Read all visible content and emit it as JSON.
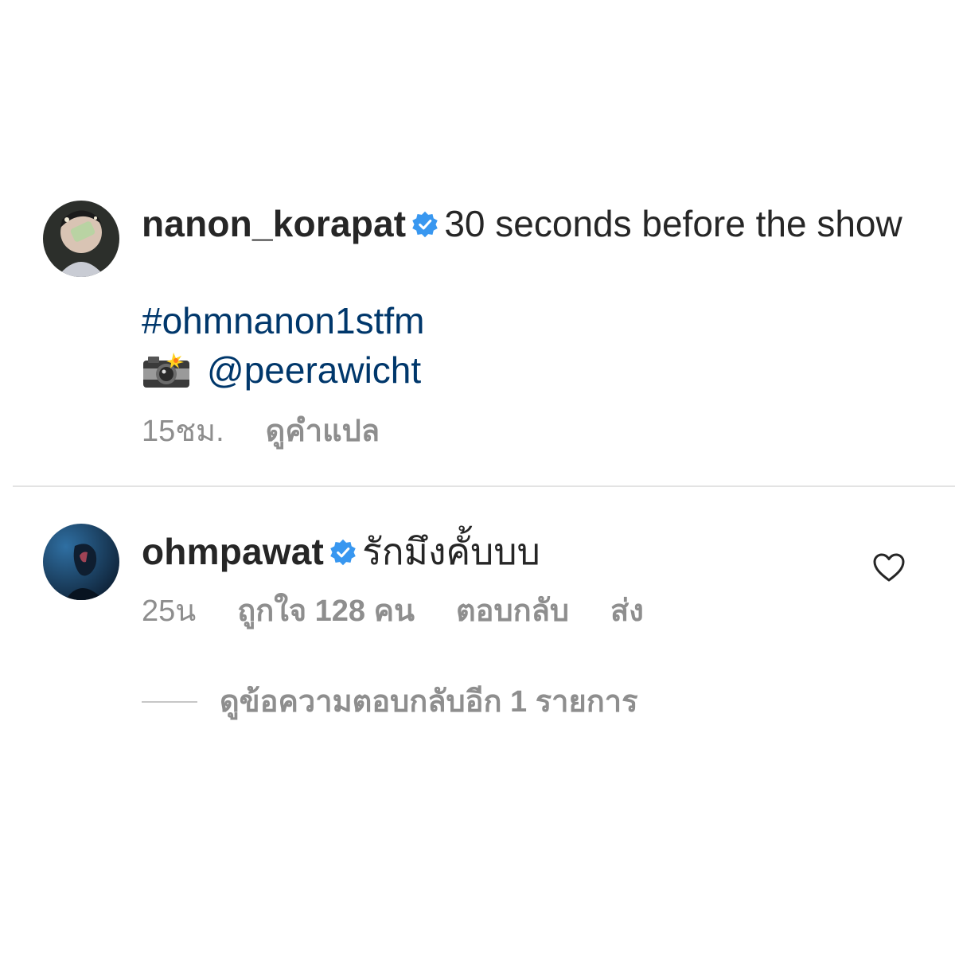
{
  "post": {
    "username": "nanon_korapat",
    "caption": "30 seconds before the show",
    "hashtag": "#ohmnanon1stfm",
    "credit_icon": "camera-with-flash-icon",
    "credit_mention": "@peerawicht",
    "time": "15ชม.",
    "translate_label": "ดูคำแปล"
  },
  "comment": {
    "username": "ohmpawat",
    "text": "รักมึงคั้บบบ",
    "time": "25น",
    "likes_label": "ถูกใจ 128 คน",
    "reply_label": "ตอบกลับ",
    "send_label": "ส่ง",
    "like_icon": "heart-outline-icon",
    "view_replies_label": "ดูข้อความตอบกลับอีก 1 รายการ"
  },
  "colors": {
    "text": "#262626",
    "secondary": "#8e8e8e",
    "link": "#00376b",
    "verified": "#3897f0",
    "divider": "#e3e3e3"
  }
}
